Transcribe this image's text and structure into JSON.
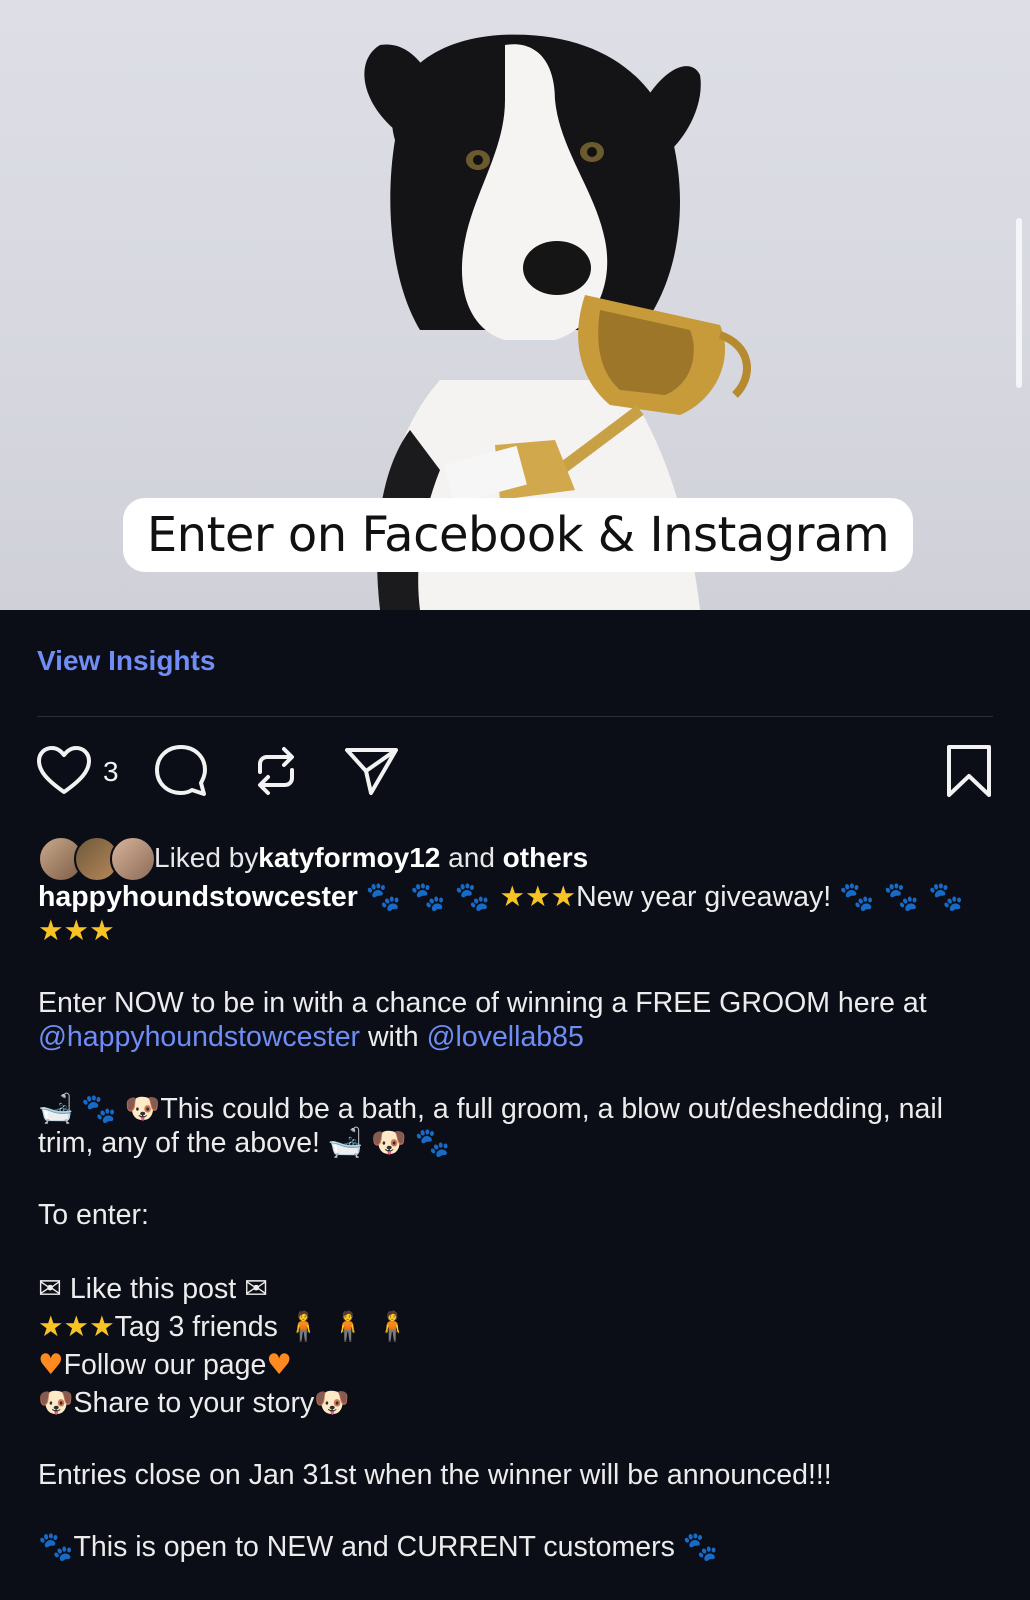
{
  "hero": {
    "overlay_text": "Enter on Facebook & Instagram"
  },
  "insights_label": "View Insights",
  "actions": {
    "like_count": "3"
  },
  "liked_by": {
    "prefix": "Liked by ",
    "user": "katyformoy12",
    "middle": " and ",
    "others": "others"
  },
  "caption": {
    "username": "happyhoundstowcester",
    "headline": "New year giveaway!",
    "line1": "Enter NOW to be in with a chance of winning a FREE GROOM here at ",
    "mention1": "@happyhoundstowcester",
    "with_word": " with ",
    "mention2": "@lovellab85",
    "services": "This could be a bath, a full groom, a blow out/deshedding, nail trim, any of the above!",
    "to_enter": "To enter:",
    "step1": "Like this post",
    "step2": "Tag 3 friends",
    "step3": "Follow our page",
    "step4": "Share to your story",
    "closing": "Entries close on Jan 31st when the winner will be announced!!!",
    "open_to": "This is open to NEW and CURRENT customers"
  },
  "icons": [
    "heart-icon",
    "comment-icon",
    "repost-icon",
    "send-icon",
    "bookmark-icon",
    "paw-icon",
    "star-icon",
    "bathtub-icon",
    "dog-face-icon",
    "envelope-icon",
    "person-icon",
    "orange-heart-icon"
  ],
  "colors": {
    "background": "#0b0e17",
    "link": "#6f8df5",
    "text": "#ececec"
  }
}
